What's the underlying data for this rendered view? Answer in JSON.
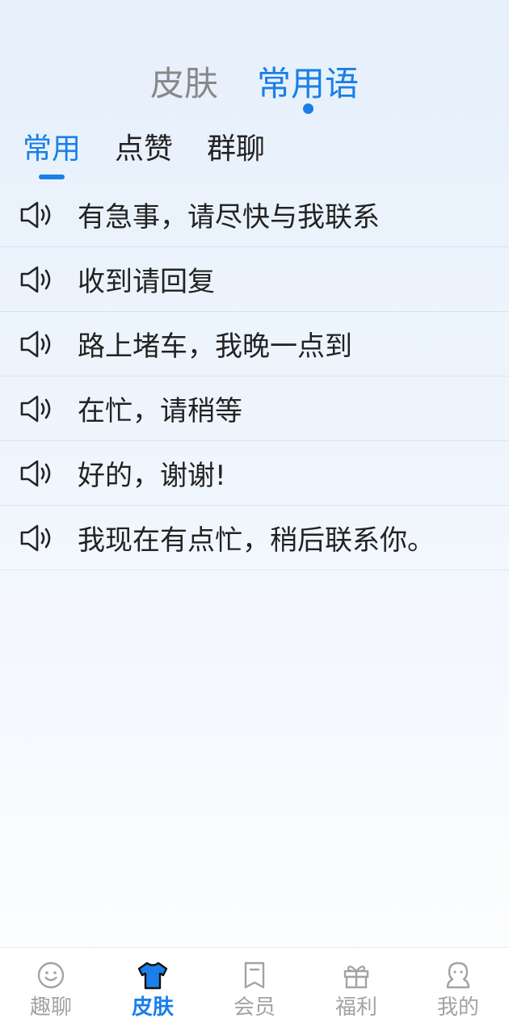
{
  "top_tabs": [
    {
      "label": "皮肤",
      "active": false
    },
    {
      "label": "常用语",
      "active": true
    }
  ],
  "sub_tabs": [
    {
      "label": "常用",
      "active": true
    },
    {
      "label": "点赞",
      "active": false
    },
    {
      "label": "群聊",
      "active": false
    }
  ],
  "phrases": [
    {
      "icon": "speaker-icon",
      "text": "有急事，请尽快与我联系"
    },
    {
      "icon": "speaker-icon",
      "text": "收到请回复"
    },
    {
      "icon": "speaker-icon",
      "text": "路上堵车，我晚一点到"
    },
    {
      "icon": "speaker-icon",
      "text": "在忙，请稍等"
    },
    {
      "icon": "speaker-icon",
      "text": "好的，谢谢!"
    },
    {
      "icon": "speaker-icon",
      "text": "我现在有点忙，稍后联系你。"
    }
  ],
  "bottom_nav": [
    {
      "icon": "smiley-icon",
      "label": "趣聊",
      "active": false
    },
    {
      "icon": "tshirt-icon",
      "label": "皮肤",
      "active": true
    },
    {
      "icon": "bookmark-icon",
      "label": "会员",
      "active": false
    },
    {
      "icon": "gift-icon",
      "label": "福利",
      "active": false
    },
    {
      "icon": "profile-icon",
      "label": "我的",
      "active": false
    }
  ],
  "colors": {
    "accent": "#1a7fe8",
    "inactive_tab": "#888888",
    "text": "#222222",
    "nav_inactive": "#a3a3a3"
  }
}
